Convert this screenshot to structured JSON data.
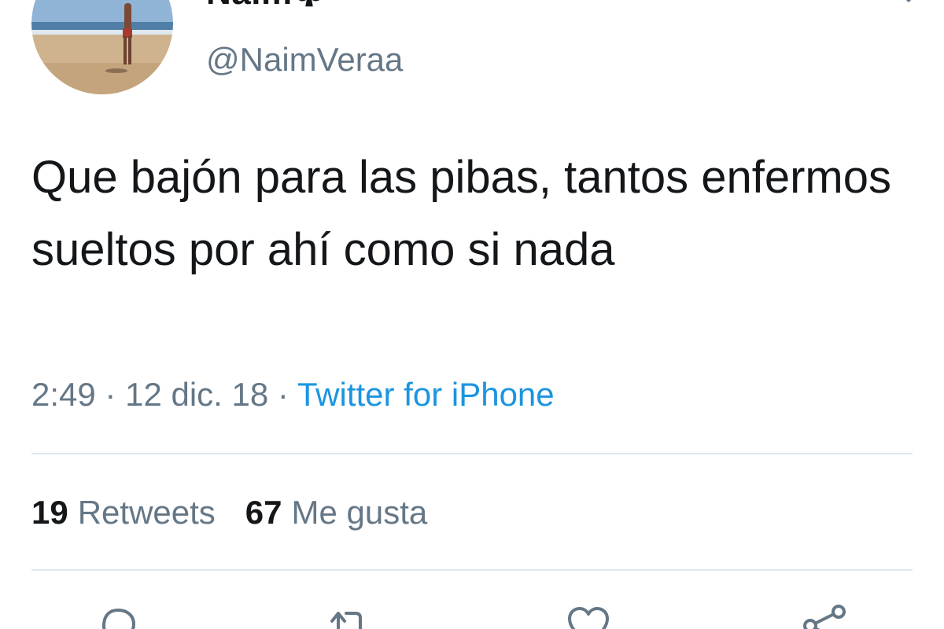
{
  "user": {
    "display_name": "Naim",
    "name_emoji": "club-suit-icon",
    "handle": "@NaimVeraa"
  },
  "tweet": {
    "text": "Que bajón para las pibas, tantos enfermos sueltos por ahí como si nada",
    "time": "2:49",
    "separator": "·",
    "date": "12 dic. 18",
    "source": "Twitter for iPhone"
  },
  "stats": {
    "retweets_count": "19",
    "retweets_label": "Retweets",
    "likes_count": "67",
    "likes_label": "Me gusta"
  },
  "actions": [
    "reply-icon",
    "retweet-icon",
    "like-icon",
    "share-icon"
  ],
  "colors": {
    "text": "#14171a",
    "secondary": "#657786",
    "link": "#1b95e0",
    "divider": "#e1e8ed"
  }
}
